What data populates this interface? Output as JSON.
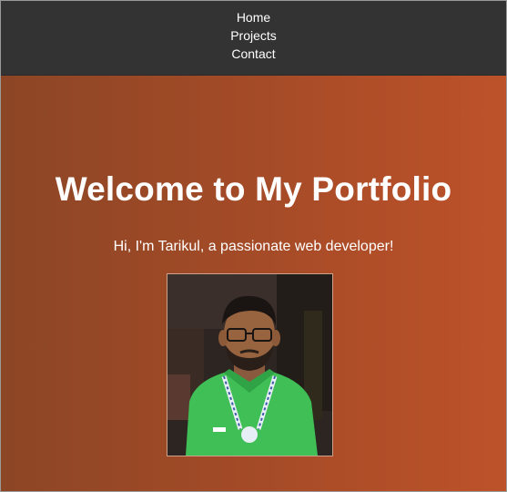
{
  "nav": {
    "items": [
      {
        "label": "Home"
      },
      {
        "label": "Projects"
      },
      {
        "label": "Contact"
      }
    ]
  },
  "hero": {
    "title": "Welcome to My Portfolio",
    "subtitle": "Hi, I'm Tarikul, a passionate web developer!"
  },
  "photo": {
    "subject": "profile-photo"
  },
  "colors": {
    "navbar_bg": "#333333",
    "gradient_start": "#8c4625",
    "gradient_end": "#bd522a",
    "text": "#ffffff",
    "shirt": "#3fbf55"
  }
}
